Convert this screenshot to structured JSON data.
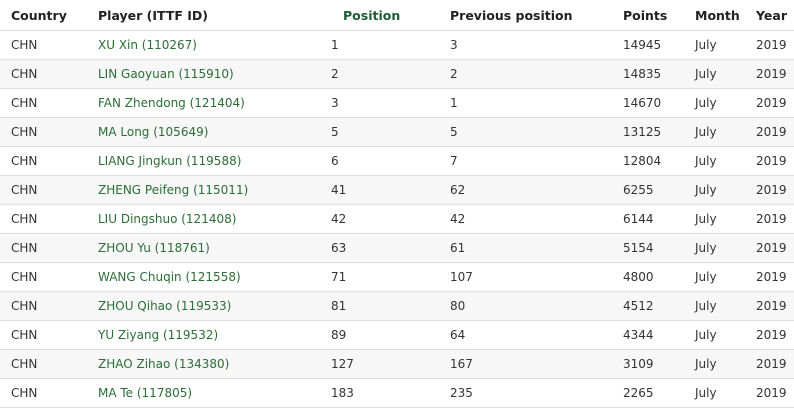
{
  "table": {
    "headers": {
      "country": "Country",
      "player": "Player (ITTF ID)",
      "position": "Position",
      "previous_position": "Previous position",
      "points": "Points",
      "month": "Month",
      "year": "Year"
    },
    "sorted_column": "position",
    "rows": [
      {
        "country": "CHN",
        "player": "XU Xin (110267)",
        "position": "1",
        "previous_position": "3",
        "points": "14945",
        "month": "July",
        "year": "2019"
      },
      {
        "country": "CHN",
        "player": "LIN Gaoyuan (115910)",
        "position": "2",
        "previous_position": "2",
        "points": "14835",
        "month": "July",
        "year": "2019"
      },
      {
        "country": "CHN",
        "player": "FAN Zhendong (121404)",
        "position": "3",
        "previous_position": "1",
        "points": "14670",
        "month": "July",
        "year": "2019"
      },
      {
        "country": "CHN",
        "player": "MA Long (105649)",
        "position": "5",
        "previous_position": "5",
        "points": "13125",
        "month": "July",
        "year": "2019"
      },
      {
        "country": "CHN",
        "player": "LIANG Jingkun (119588)",
        "position": "6",
        "previous_position": "7",
        "points": "12804",
        "month": "July",
        "year": "2019"
      },
      {
        "country": "CHN",
        "player": "ZHENG Peifeng (115011)",
        "position": "41",
        "previous_position": "62",
        "points": "6255",
        "month": "July",
        "year": "2019"
      },
      {
        "country": "CHN",
        "player": "LIU Dingshuo (121408)",
        "position": "42",
        "previous_position": "42",
        "points": "6144",
        "month": "July",
        "year": "2019"
      },
      {
        "country": "CHN",
        "player": "ZHOU Yu (118761)",
        "position": "63",
        "previous_position": "61",
        "points": "5154",
        "month": "July",
        "year": "2019"
      },
      {
        "country": "CHN",
        "player": "WANG Chuqin (121558)",
        "position": "71",
        "previous_position": "107",
        "points": "4800",
        "month": "July",
        "year": "2019"
      },
      {
        "country": "CHN",
        "player": "ZHOU Qihao (119533)",
        "position": "81",
        "previous_position": "80",
        "points": "4512",
        "month": "July",
        "year": "2019"
      },
      {
        "country": "CHN",
        "player": "YU Ziyang (119532)",
        "position": "89",
        "previous_position": "64",
        "points": "4344",
        "month": "July",
        "year": "2019"
      },
      {
        "country": "CHN",
        "player": "ZHAO Zihao (134380)",
        "position": "127",
        "previous_position": "167",
        "points": "3109",
        "month": "July",
        "year": "2019"
      },
      {
        "country": "CHN",
        "player": "MA Te (117805)",
        "position": "183",
        "previous_position": "235",
        "points": "2265",
        "month": "July",
        "year": "2019"
      }
    ]
  },
  "colors": {
    "link": "#2b6e36",
    "sorted_header": "#1e5c34",
    "row_stripe": "#f7f7f7",
    "row_border": "#dcdcdc"
  }
}
